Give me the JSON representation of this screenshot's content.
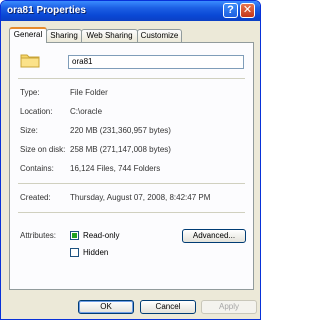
{
  "window": {
    "title": "ora81 Properties",
    "help_label": "?",
    "close_label": "✕"
  },
  "tabs": [
    {
      "label": "General"
    },
    {
      "label": "Sharing"
    },
    {
      "label": "Web Sharing"
    },
    {
      "label": "Customize"
    }
  ],
  "folder": {
    "name": "ora81"
  },
  "properties": {
    "type_label": "Type:",
    "type_value": "File Folder",
    "location_label": "Location:",
    "location_value": "C:\\oracle",
    "size_label": "Size:",
    "size_value": "220 MB (231,360,957 bytes)",
    "size_on_disk_label": "Size on disk:",
    "size_on_disk_value": "258 MB (271,147,008 bytes)",
    "contains_label": "Contains:",
    "contains_value": "16,124 Files, 744 Folders",
    "created_label": "Created:",
    "created_value": "Thursday, August 07, 2008, 8:42:47 PM"
  },
  "attributes": {
    "label": "Attributes:",
    "readonly_label": "Read-only",
    "readonly_state": "indeterminate",
    "hidden_label": "Hidden",
    "hidden_state": "unchecked",
    "advanced_label": "Advanced..."
  },
  "buttons": {
    "ok": "OK",
    "cancel": "Cancel",
    "apply": "Apply"
  },
  "colors": {
    "titlebar": "#0a49d6",
    "tab_accent": "#e68b2c",
    "checkbox_fill": "#21a121"
  }
}
